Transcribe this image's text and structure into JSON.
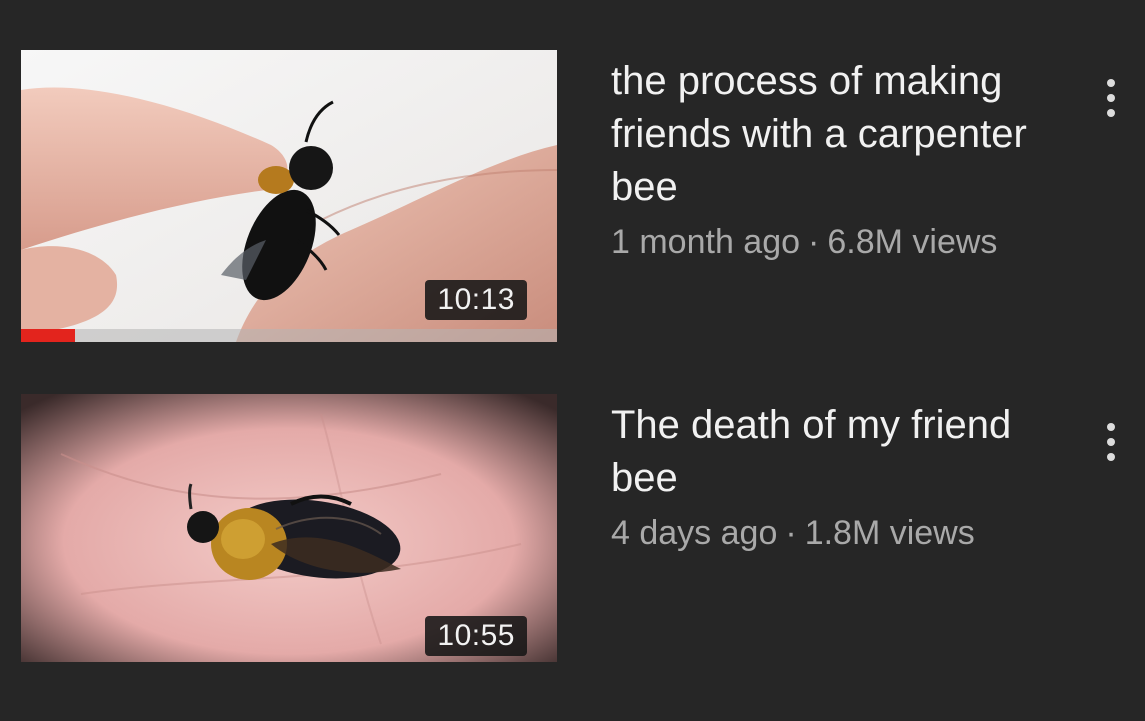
{
  "videos": [
    {
      "title": "the process of making friends with a carpenter bee",
      "age": "1 month ago",
      "separator": "·",
      "views": "6.8M views",
      "duration": "10:13",
      "watch_progress": 0.1,
      "progress_color": "#e3241d",
      "menu_icon": "more-vert-icon"
    },
    {
      "title": "The death of my friend bee",
      "age": "4 days ago",
      "separator": "·",
      "views": "1.8M views",
      "duration": "10:55",
      "menu_icon": "more-vert-icon"
    }
  ],
  "colors": {
    "background": "#262626",
    "title_text": "#f1f1f1",
    "meta_text": "#a9a9a9"
  }
}
